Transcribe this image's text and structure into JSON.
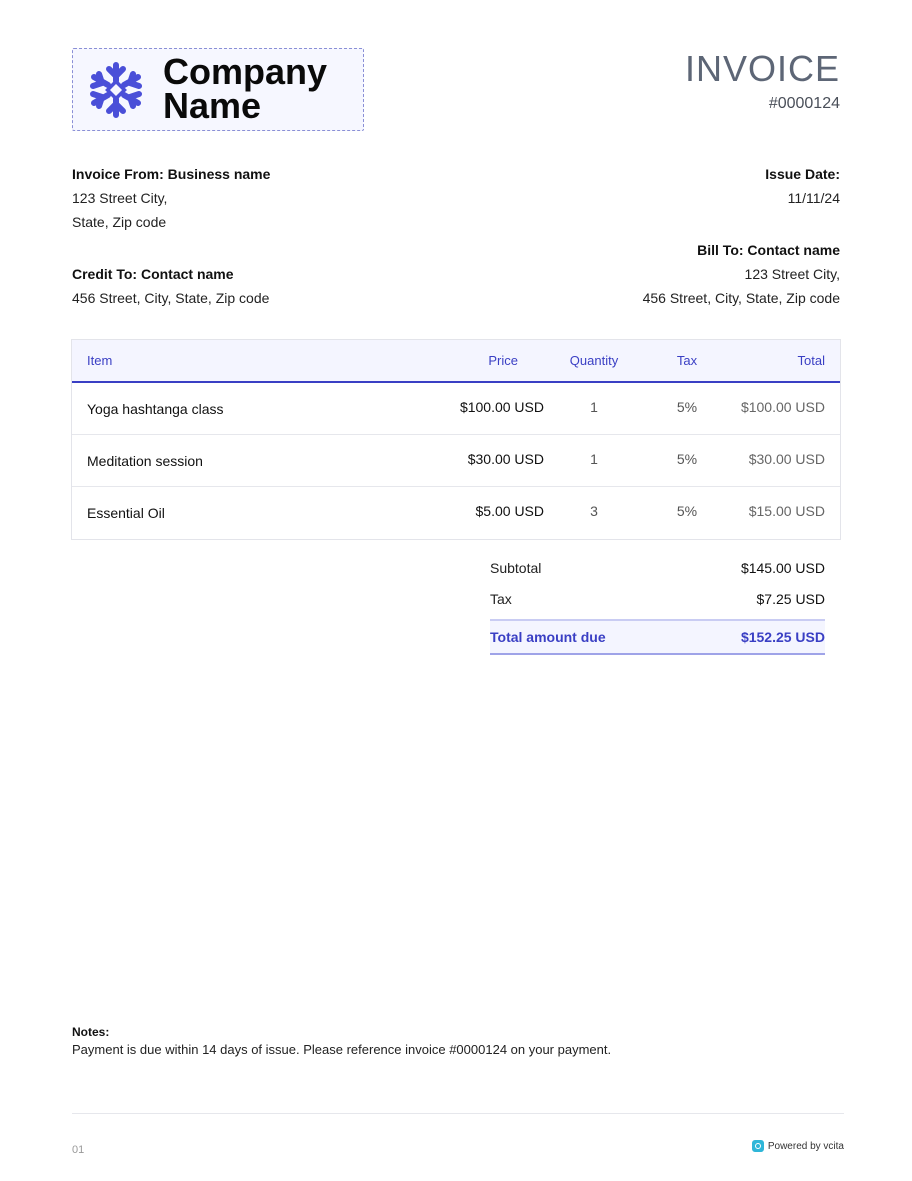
{
  "logo": {
    "line1": "Company",
    "line2": "Name",
    "icon": "snowflake-icon",
    "brand_color": "#4a4fd8"
  },
  "header": {
    "title": "INVOICE",
    "number": "#0000124"
  },
  "from": {
    "label": "Invoice From: Business name",
    "line1": "123 Street City,",
    "line2": "State, Zip code"
  },
  "issue": {
    "label": "Issue Date:",
    "date": "11/11/24"
  },
  "bill_to": {
    "label": "Bill To: Contact name",
    "line1": "123 Street City,",
    "line2": "456 Street, City, State, Zip code"
  },
  "credit_to": {
    "label": "Credit To: Contact name",
    "line1": "456 Street, City, State, Zip code"
  },
  "table": {
    "headers": {
      "item": "Item",
      "price": "Price",
      "quantity": "Quantity",
      "tax": "Tax",
      "total": "Total"
    },
    "rows": [
      {
        "item": "Yoga hashtanga class",
        "price": "$100.00 USD",
        "quantity": "1",
        "tax": "5%",
        "total": "$100.00 USD"
      },
      {
        "item": "Meditation session",
        "price": "$30.00 USD",
        "quantity": "1",
        "tax": "5%",
        "total": "$30.00 USD"
      },
      {
        "item": "Essential Oil",
        "price": "$5.00 USD",
        "quantity": "3",
        "tax": "5%",
        "total": "$15.00 USD"
      }
    ]
  },
  "summary": {
    "subtotal_label": "Subtotal",
    "subtotal_value": "$145.00 USD",
    "tax_label": "Tax",
    "tax_value": "$7.25 USD",
    "due_label": "Total amount due",
    "due_value": "$152.25 USD",
    "accent_color": "#3a3fc4"
  },
  "notes": {
    "title": "Notes:",
    "text": "Payment is due within 14 days of issue. Please reference invoice #0000124 on your payment."
  },
  "footer": {
    "page": "01",
    "powered": "Powered by vcita",
    "powered_icon": "vcita-logo-icon"
  }
}
